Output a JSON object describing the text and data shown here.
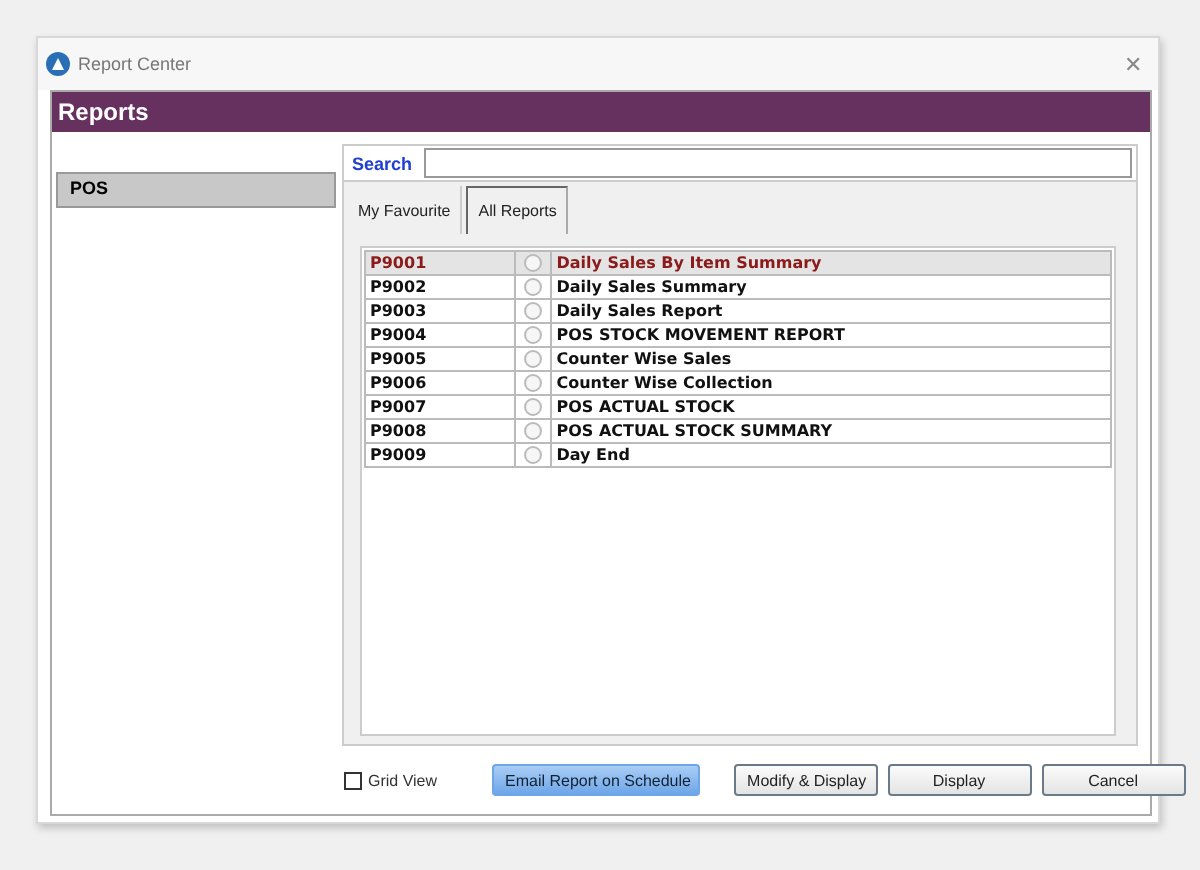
{
  "window": {
    "title": "Report Center",
    "close": "✕"
  },
  "header": {
    "title": "Reports"
  },
  "sidebar": {
    "items": [
      {
        "label": "POS",
        "selected": true
      }
    ]
  },
  "search": {
    "label": "Search"
  },
  "tabs": [
    {
      "label": "My Favourite",
      "selected": false
    },
    {
      "label": "All Reports",
      "selected": true
    }
  ],
  "table": {
    "rows": [
      {
        "code": "P9001",
        "name": "Daily Sales By Item Summary",
        "selected": true,
        "checked": false
      },
      {
        "code": "P9002",
        "name": "Daily Sales Summary",
        "selected": false,
        "checked": false
      },
      {
        "code": "P9003",
        "name": "Daily Sales Report",
        "selected": false,
        "checked": false
      },
      {
        "code": "P9004",
        "name": "POS STOCK MOVEMENT REPORT",
        "selected": false,
        "checked": false
      },
      {
        "code": "P9005",
        "name": "Counter Wise Sales",
        "selected": false,
        "checked": false
      },
      {
        "code": "P9006",
        "name": "Counter Wise Collection",
        "selected": false,
        "checked": false
      },
      {
        "code": "P9007",
        "name": "POS ACTUAL STOCK",
        "selected": false,
        "checked": false
      },
      {
        "code": "P9008",
        "name": "POS ACTUAL STOCK SUMMARY",
        "selected": false,
        "checked": false
      },
      {
        "code": "P9009",
        "name": "Day End",
        "selected": false,
        "checked": false
      }
    ]
  },
  "grid_view": {
    "label": "Grid View",
    "checked": false
  },
  "buttons": [
    {
      "label": "Email Report on Schedule",
      "kind": "primary"
    },
    {
      "label": "Modify & Display",
      "kind": "normal"
    },
    {
      "label": "Display",
      "kind": "normal"
    },
    {
      "label": "Cancel",
      "kind": "normal"
    }
  ]
}
